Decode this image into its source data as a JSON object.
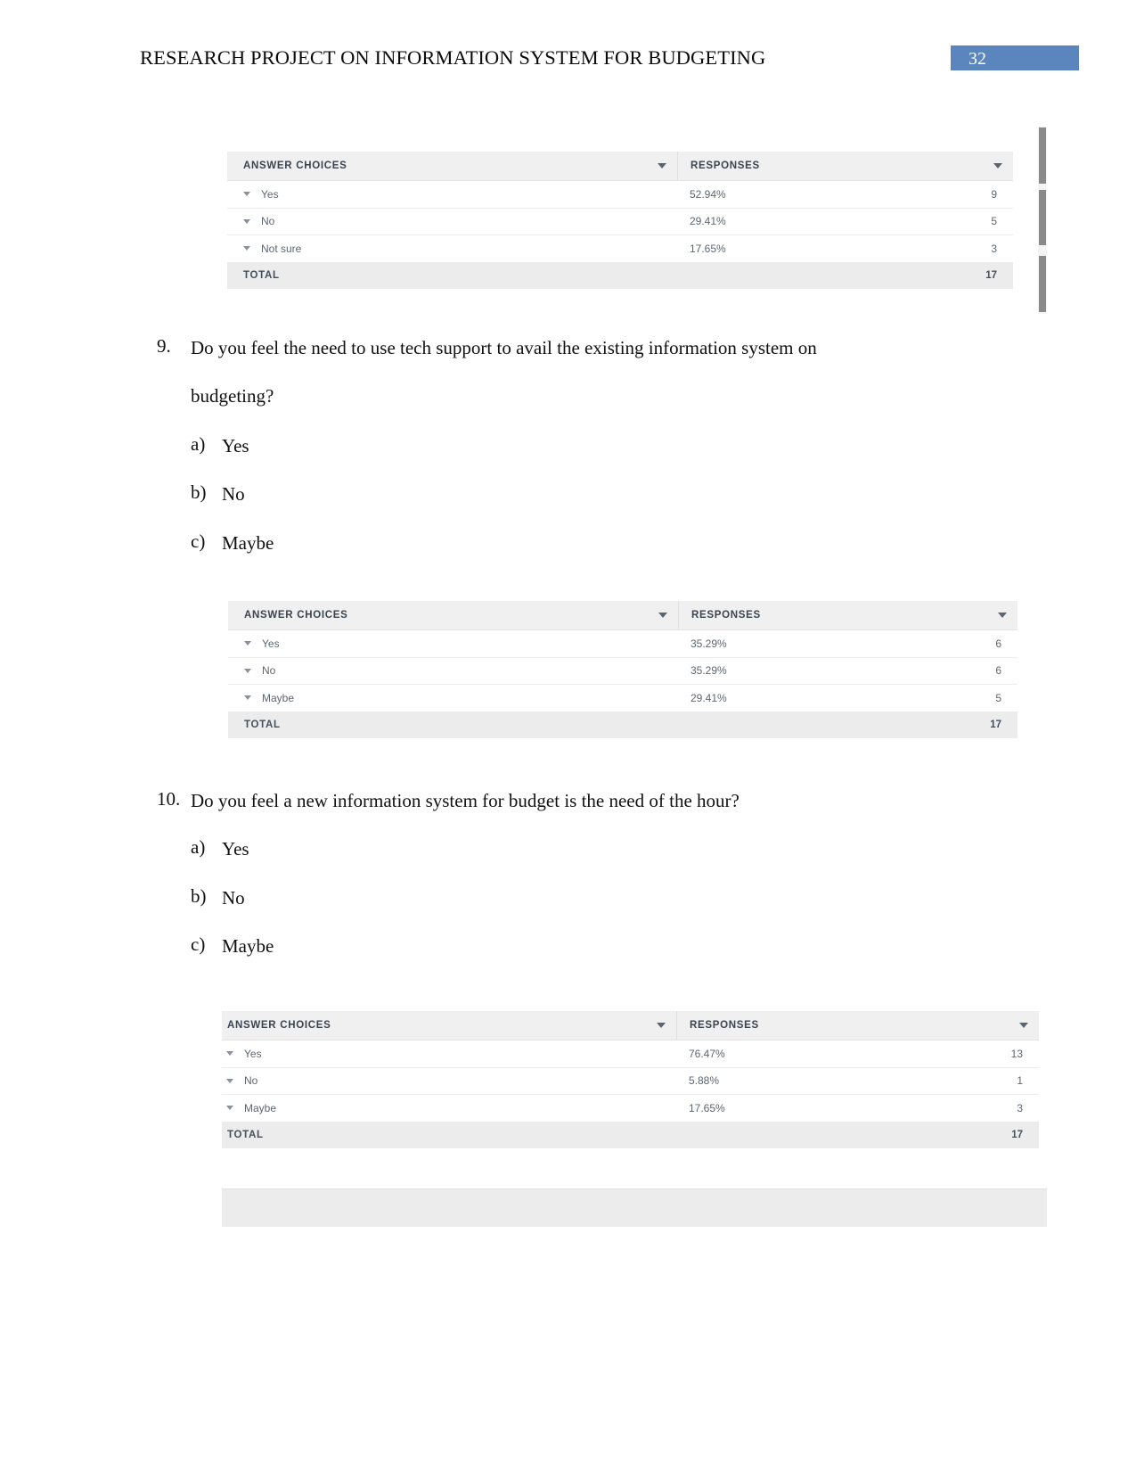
{
  "header": {
    "title": "RESEARCH PROJECT ON INFORMATION SYSTEM FOR BUDGETING",
    "page_number": "32",
    "page_number_bg": "#5b85bd"
  },
  "tables": {
    "columns": {
      "answer_choices": "ANSWER CHOICES",
      "responses": "RESPONSES",
      "total": "TOTAL"
    },
    "table1": {
      "rows": [
        {
          "label": "Yes",
          "percent": "52.94%",
          "count": "9"
        },
        {
          "label": "No",
          "percent": "29.41%",
          "count": "5"
        },
        {
          "label": "Not sure",
          "percent": "17.65%",
          "count": "3"
        }
      ],
      "total_label": "TOTAL",
      "total_count": "17"
    },
    "table2": {
      "rows": [
        {
          "label": "Yes",
          "percent": "35.29%",
          "count": "6"
        },
        {
          "label": "No",
          "percent": "35.29%",
          "count": "6"
        },
        {
          "label": "Maybe",
          "percent": "29.41%",
          "count": "5"
        }
      ],
      "total_label": "TOTAL",
      "total_count": "17"
    },
    "table3": {
      "header_answer_choices": "ANSWER CHOICES",
      "rows": [
        {
          "label": "Yes",
          "percent": "76.47%",
          "count": "13"
        },
        {
          "label": "No",
          "percent": "5.88%",
          "count": "1"
        },
        {
          "label": "Maybe",
          "percent": "17.65%",
          "count": "3"
        }
      ],
      "total_label": "TOTAL",
      "total_count": "17"
    }
  },
  "questions": [
    {
      "number": "9.",
      "text_line1": "Do you feel the need to use tech support to avail the existing information system on",
      "text_line2": "budgeting?",
      "options": [
        {
          "marker": "a)",
          "label": "Yes"
        },
        {
          "marker": "b)",
          "label": "No"
        },
        {
          "marker": "c)",
          "label": "Maybe"
        }
      ]
    },
    {
      "number": "10.",
      "text_line1": "Do you feel a new information system for budget is the need of the hour?",
      "options": [
        {
          "marker": "a)",
          "label": "Yes"
        },
        {
          "marker": "b)",
          "label": "No"
        },
        {
          "marker": "c)",
          "label": "Maybe"
        }
      ]
    }
  ],
  "chart_data": [
    {
      "type": "table",
      "title": "Question 8 responses",
      "categories": [
        "Yes",
        "No",
        "Not sure"
      ],
      "values": [
        52.94,
        29.41,
        17.65
      ],
      "counts": [
        9,
        5,
        3
      ],
      "total": 17,
      "ylabel": "RESPONSES"
    },
    {
      "type": "table",
      "title": "Do you feel the need to use tech support to avail the existing information system on budgeting?",
      "categories": [
        "Yes",
        "No",
        "Maybe"
      ],
      "values": [
        35.29,
        35.29,
        29.41
      ],
      "counts": [
        6,
        6,
        5
      ],
      "total": 17,
      "ylabel": "RESPONSES"
    },
    {
      "type": "table",
      "title": "Do you feel a new information system for budget is the need of the hour?",
      "categories": [
        "Yes",
        "No",
        "Maybe"
      ],
      "values": [
        76.47,
        5.88,
        17.65
      ],
      "counts": [
        13,
        1,
        3
      ],
      "total": 17,
      "ylabel": "RESPONSES"
    }
  ]
}
